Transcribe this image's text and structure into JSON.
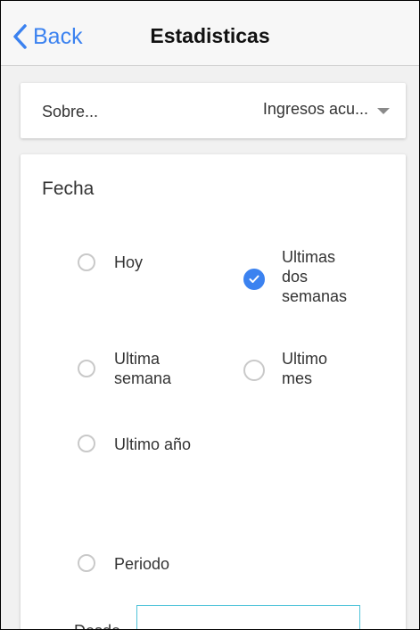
{
  "header": {
    "back_label": "Back",
    "title": "Estadisticas"
  },
  "about": {
    "label": "Sobre...",
    "value": "Ingresos acu..."
  },
  "fecha": {
    "title": "Fecha",
    "options": [
      {
        "label": "Hoy",
        "checked": false
      },
      {
        "label": "Ultimas dos semanas",
        "checked": true
      },
      {
        "label": "Ultima semana",
        "checked": false
      },
      {
        "label": "Ultimo mes",
        "checked": false
      },
      {
        "label": "Ultimo año",
        "checked": false
      },
      {
        "label": "Periodo",
        "checked": false
      }
    ],
    "from_label": "Desde"
  },
  "colors": {
    "accent": "#3b82f0",
    "input_border": "#4fc3d9"
  },
  "icons": {
    "back": "chevron-left-icon",
    "dropdown": "caret-down-icon",
    "check": "check-icon"
  }
}
